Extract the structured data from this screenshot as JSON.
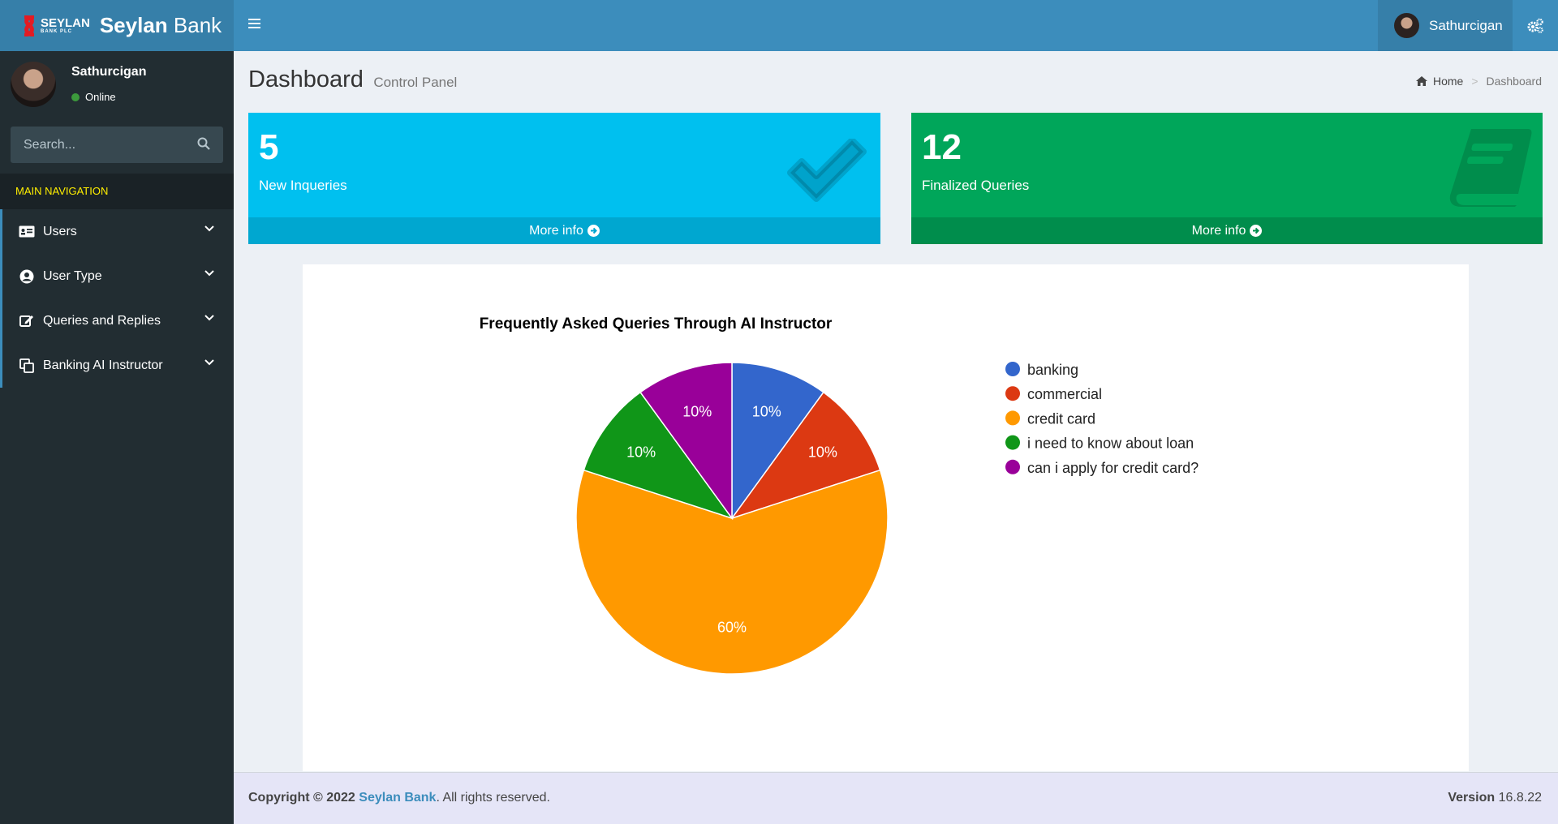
{
  "header": {
    "logo_small_top": "SEYLAN",
    "logo_small_bottom": "BANK PLC",
    "brand_bold": "Seylan",
    "brand_light": "Bank",
    "user_name": "Sathurcigan"
  },
  "sidebar": {
    "user_name": "Sathurcigan",
    "status": "Online",
    "search_placeholder": "Search...",
    "nav_header": "MAIN NAVIGATION",
    "items": [
      {
        "label": "Users",
        "icon": "id-card-icon"
      },
      {
        "label": "User Type",
        "icon": "user-circle-icon"
      },
      {
        "label": "Queries and Replies",
        "icon": "edit-icon"
      },
      {
        "label": "Banking AI Instructor",
        "icon": "copy-icon"
      }
    ]
  },
  "content": {
    "title": "Dashboard",
    "subtitle": "Control Panel",
    "breadcrumb_home": "Home",
    "breadcrumb_current": "Dashboard"
  },
  "boxes": [
    {
      "value": "5",
      "label": "New Inqueries",
      "more": "More info",
      "color": "#00c0ef",
      "icon": "check-icon"
    },
    {
      "value": "12",
      "label": "Finalized Queries",
      "more": "More info",
      "color": "#00a65a",
      "icon": "book-icon"
    }
  ],
  "chart_data": {
    "type": "pie",
    "title": "Frequently Asked Queries Through AI Instructor",
    "labels": [
      "banking",
      "commercial",
      "credit card",
      "i need to know about loan",
      "can i apply for credit card?"
    ],
    "values": [
      10,
      10,
      60,
      10,
      10
    ],
    "slice_labels": [
      "10%",
      "10%",
      "60%",
      "10%",
      "10%"
    ],
    "colors": [
      "#3366cc",
      "#dc3912",
      "#ff9900",
      "#109618",
      "#990099"
    ],
    "legend_position": "right"
  },
  "footer": {
    "copyright_prefix": "Copyright © 2022",
    "brand": "Seylan Bank",
    "suffix": ". All rights reserved.",
    "version_label": "Version",
    "version": "16.8.22"
  }
}
